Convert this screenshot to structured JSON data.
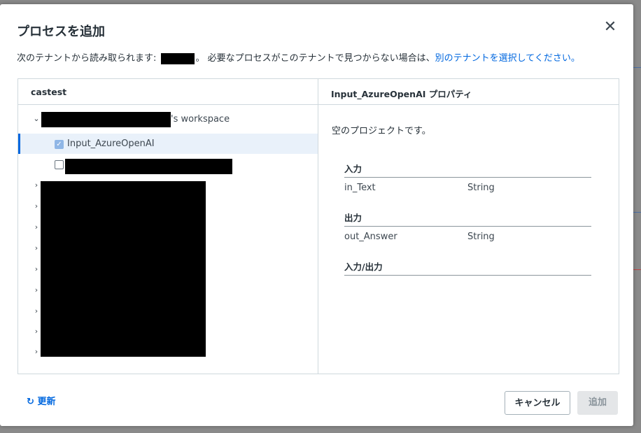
{
  "dialog": {
    "title": "プロセスを追加",
    "close_glyph": "✕",
    "subtitle_prefix": "次のテナントから読み取られます: ",
    "subtitle_middle": "。 必要なプロセスがこのテナントで見つからない場合は、",
    "subtitle_link": "別のテナントを選択してください。"
  },
  "left_panel": {
    "header": "castest",
    "workspace_suffix": "'s workspace",
    "items": [
      {
        "label": "Input_AzureOpenAI",
        "checked": true
      },
      {
        "label": "",
        "checked": false
      }
    ],
    "collapsed_folder_count": 9
  },
  "right_panel": {
    "header": "Input_AzureOpenAI プロパティ",
    "description": "空のプロジェクトです。",
    "sections": [
      {
        "title": "入力",
        "args": [
          {
            "name": "in_Text",
            "type": "String"
          }
        ]
      },
      {
        "title": "出力",
        "args": [
          {
            "name": "out_Answer",
            "type": "String"
          }
        ]
      },
      {
        "title": "入力/出力",
        "args": []
      }
    ]
  },
  "footer": {
    "refresh_label": "更新",
    "cancel_label": "キャンセル",
    "add_label": "追加"
  },
  "icons": {
    "expand": "chevron-down-icon",
    "collapse": "chevron-right-icon",
    "refresh": "refresh-icon",
    "close": "close-icon",
    "check": "checkmark-icon"
  },
  "colors": {
    "accent": "#0067df",
    "selection_bg": "#e9f1fa",
    "disabled_bg": "#e4e6e8"
  }
}
